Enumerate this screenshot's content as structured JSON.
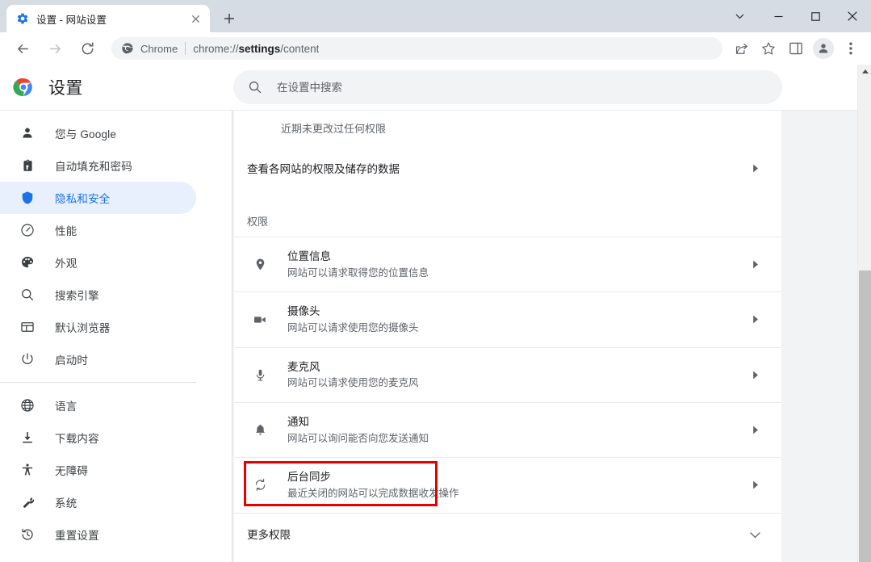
{
  "window": {
    "controls": {
      "caret_label": "▾",
      "minimize_label": "—",
      "maximize_label": "□",
      "close_label": "✕"
    }
  },
  "tabstrip": {
    "tabs": [
      {
        "title": "设置 - 网站设置",
        "favicon": "gear-icon",
        "active": true
      }
    ],
    "new_tab_label": "+"
  },
  "toolbar": {
    "back_label": "←",
    "forward_label": "→",
    "reload_label": "⟳",
    "omnibox": {
      "scheme_label": "Chrome",
      "url_prefix": "chrome://",
      "url_host": "settings",
      "url_suffix": "/content"
    },
    "icons": [
      "share-icon",
      "bookmark-star-icon",
      "side-panel-icon",
      "profile-avatar-icon",
      "three-dot-menu-icon"
    ]
  },
  "settings": {
    "brand_title": "设置",
    "search": {
      "placeholder": "在设置中搜索",
      "value": ""
    }
  },
  "sidebar": {
    "groups": [
      {
        "items": [
          {
            "label": "您与 Google",
            "icon": "person-icon",
            "active": false
          },
          {
            "label": "自动填充和密码",
            "icon": "clipboard-key-icon",
            "active": false
          },
          {
            "label": "隐私和安全",
            "icon": "shield-icon",
            "active": true
          },
          {
            "label": "性能",
            "icon": "speedometer-icon",
            "active": false
          },
          {
            "label": "外观",
            "icon": "palette-icon",
            "active": false
          },
          {
            "label": "搜索引擎",
            "icon": "search-icon",
            "active": false
          },
          {
            "label": "默认浏览器",
            "icon": "browser-window-icon",
            "active": false
          },
          {
            "label": "启动时",
            "icon": "power-icon",
            "active": false
          }
        ]
      },
      {
        "items": [
          {
            "label": "语言",
            "icon": "globe-icon",
            "active": false
          },
          {
            "label": "下载内容",
            "icon": "download-icon",
            "active": false
          },
          {
            "label": "无障碍",
            "icon": "accessibility-icon",
            "active": false
          },
          {
            "label": "系统",
            "icon": "wrench-icon",
            "active": false
          },
          {
            "label": "重置设置",
            "icon": "history-restore-icon",
            "active": false
          }
        ]
      }
    ]
  },
  "content": {
    "recent_activity_text": "近期未更改过任何权限",
    "all_sites_row": {
      "label": "查看各网站的权限及储存的数据",
      "arrow": "chevron-right-icon"
    },
    "permissions_section_title": "权限",
    "permissions": [
      {
        "title": "位置信息",
        "subtitle": "网站可以请求取得您的位置信息",
        "icon": "location-pin-icon",
        "highlighted": false
      },
      {
        "title": "摄像头",
        "subtitle": "网站可以请求使用您的摄像头",
        "icon": "video-camera-icon",
        "highlighted": false
      },
      {
        "title": "麦克风",
        "subtitle": "网站可以请求使用您的麦克风",
        "icon": "microphone-icon",
        "highlighted": true
      },
      {
        "title": "通知",
        "subtitle": "网站可以询问能否向您发送通知",
        "icon": "bell-icon",
        "highlighted": false
      },
      {
        "title": "后台同步",
        "subtitle": "最近关闭的网站可以完成数据收发操作",
        "icon": "sync-icon",
        "highlighted": false
      }
    ],
    "more_permissions": {
      "label": "更多权限",
      "chevron": "chevron-down-icon"
    }
  },
  "colors": {
    "accent": "#1a73e8",
    "accent_bg": "#e8f0fe",
    "highlight_box": "#e60000",
    "text_primary": "#202124",
    "text_secondary": "#5f6368",
    "window_frame": "#d6dce3"
  }
}
